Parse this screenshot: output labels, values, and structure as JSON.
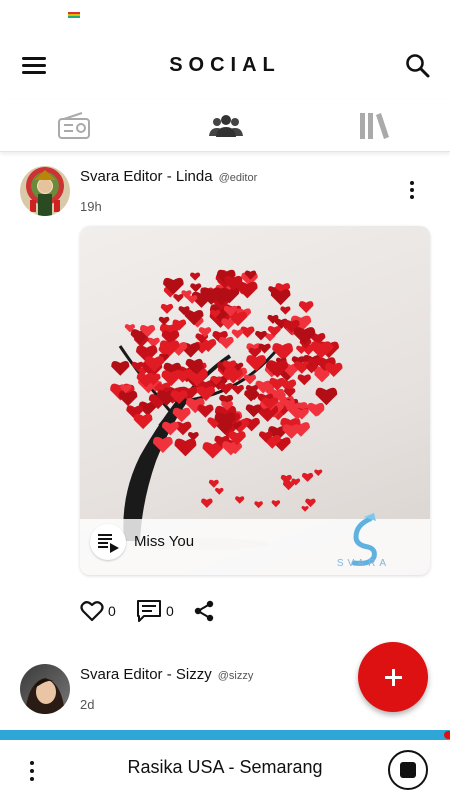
{
  "app": {
    "title": "SOCIAL"
  },
  "tabs": [
    {
      "icon": "radio-icon"
    },
    {
      "icon": "people-icon"
    },
    {
      "icon": "library-icon"
    }
  ],
  "posts": [
    {
      "author": "Svara Editor - Linda",
      "handle": "@editor",
      "time": "19h",
      "media": {
        "song_title": "Miss You",
        "brand": "SVARA"
      },
      "likes": "0",
      "comments": "0"
    },
    {
      "author": "Svara Editor - Sizzy",
      "handle": "@sizzy",
      "time": "2d"
    }
  ],
  "player": {
    "station": "Rasika USA - Semarang"
  },
  "colors": {
    "accent": "#dd1111",
    "strip": "#2fa6d8"
  }
}
